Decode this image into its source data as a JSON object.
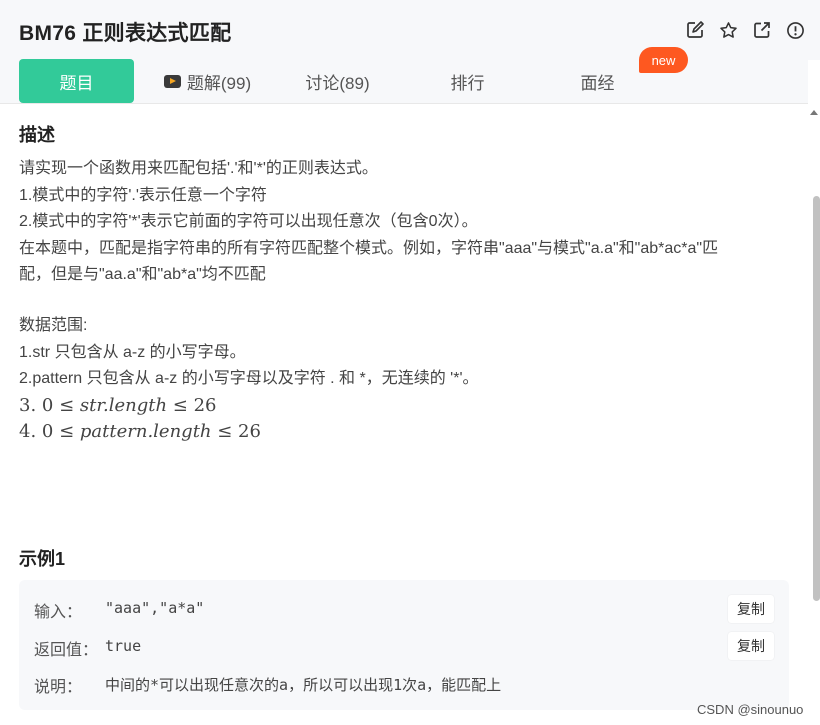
{
  "header": {
    "title": "BM76  正则表达式匹配",
    "icons": [
      "edit-icon",
      "star-icon",
      "external-link-icon",
      "info-icon"
    ]
  },
  "tabs": [
    {
      "label": "题目",
      "active": true
    },
    {
      "label": "题解(99)",
      "icon": "video-icon"
    },
    {
      "label": "讨论(89)"
    },
    {
      "label": "排行"
    },
    {
      "label": "面经"
    }
  ],
  "badge": "new",
  "description": {
    "title": "描述",
    "lines": [
      "请实现一个函数用来匹配包括'.'和'*'的正则表达式。",
      "1.模式中的字符'.'表示任意一个字符",
      "2.模式中的字符'*'表示它前面的字符可以出现任意次（包含0次）。",
      "在本题中，匹配是指字符串的所有字符匹配整个模式。例如，字符串\"aaa\"与模式\"a.a\"和\"ab*ac*a\"匹",
      "配，但是与\"aa.a\"和\"ab*a\"均不匹配"
    ],
    "range_title": "数据范围:",
    "range_lines": [
      "1.str 只包含从 a-z 的小写字母。",
      "2.pattern 只包含从 a-z 的小写字母以及字符 . 和 *，无连续的 '*'。"
    ],
    "math3_prefix": "3. 0 ≤ ",
    "math3_var": "str.length",
    "math3_suffix": " ≤ 26",
    "math4_prefix": "4. 0 ≤ ",
    "math4_var": "pattern.length",
    "math4_suffix": " ≤ 26"
  },
  "example": {
    "title": "示例1",
    "input_label": "输入：",
    "input_value": "\"aaa\",\"a*a\"",
    "output_label": "返回值：",
    "output_value": "true",
    "note_label": "说明：",
    "note_value": "中间的*可以出现任意次的a，所以可以出现1次a，能匹配上",
    "copy_label": "复制"
  },
  "watermark": "CSDN @sinounuo",
  "colors": {
    "accent": "#32ca99",
    "badge": "#fe5820"
  }
}
